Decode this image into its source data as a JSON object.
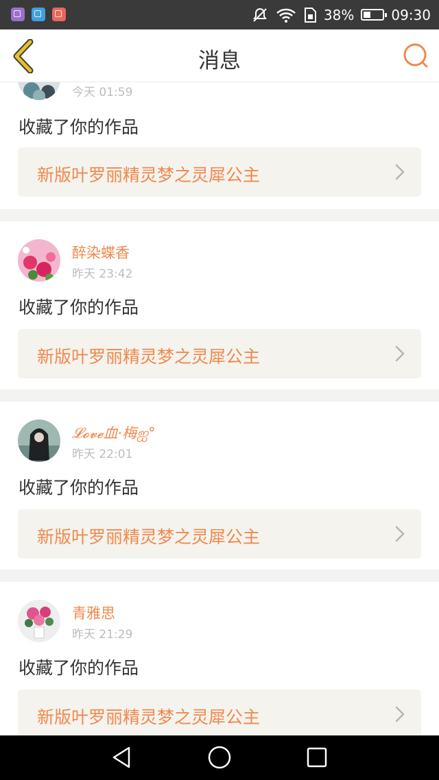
{
  "status_bar": {
    "battery_percent": "38%",
    "battery_level": 0.38,
    "time": "09:30",
    "icons": [
      "gallery-app-icon",
      "calendar-app-icon",
      "tools-app-icon",
      "mute-icon",
      "wifi-icon",
      "sim-icon"
    ],
    "app_colors": [
      "#9b6fd0",
      "#3fa0e0",
      "#e8675a"
    ]
  },
  "header": {
    "title": "消息",
    "back_icon": "chevron-left-icon",
    "search_icon": "search-icon",
    "accent": "#f0894d",
    "back_color": "#e8c028"
  },
  "notifications": [
    {
      "user": "",
      "time": "今天 01:59",
      "action": "收藏了你的作品",
      "work_title": "新版叶罗丽精灵梦之灵犀公主"
    },
    {
      "user": "醉染蝶香",
      "time": "昨天 23:42",
      "action": "收藏了你的作品",
      "work_title": "新版叶罗丽精灵梦之灵犀公主"
    },
    {
      "user": "𝓛𝓸𝓿𝓮血·梅ஐ°",
      "time": "昨天 22:01",
      "action": "收藏了你的作品",
      "work_title": "新版叶罗丽精灵梦之灵犀公主"
    },
    {
      "user": "青雅思",
      "time": "昨天 21:29",
      "action": "收藏了你的作品",
      "work_title": "新版叶罗丽精灵梦之灵犀公主"
    }
  ],
  "nav_bar": {
    "buttons": [
      "back-triangle-icon",
      "home-circle-icon",
      "recents-square-icon"
    ]
  }
}
